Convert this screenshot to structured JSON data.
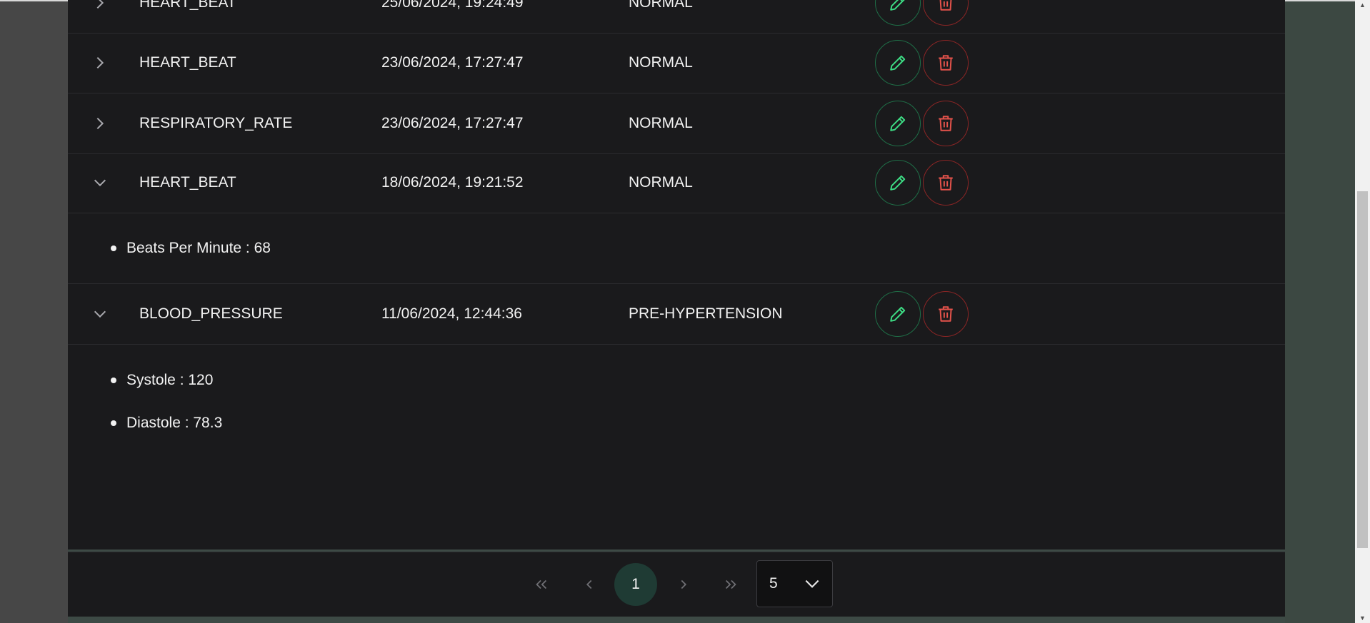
{
  "records": [
    {
      "type": "HEART_BEAT",
      "date": "25/06/2024, 19:24:49",
      "status": "NORMAL",
      "expanded": false
    },
    {
      "type": "HEART_BEAT",
      "date": "23/06/2024, 17:27:47",
      "status": "NORMAL",
      "expanded": false
    },
    {
      "type": "RESPIRATORY_RATE",
      "date": "23/06/2024, 17:27:47",
      "status": "NORMAL",
      "expanded": false
    },
    {
      "type": "HEART_BEAT",
      "date": "18/06/2024, 19:21:52",
      "status": "NORMAL",
      "expanded": true,
      "details": [
        {
          "text": "Beats Per Minute : 68"
        }
      ]
    },
    {
      "type": "BLOOD_PRESSURE",
      "date": "11/06/2024, 12:44:36",
      "status": "PRE-HYPERTENSION",
      "expanded": true,
      "details": [
        {
          "text": "Systole : 120"
        },
        {
          "text": "Diastole : 78.3"
        }
      ]
    }
  ],
  "icons": {
    "expand": "chevron-right-icon",
    "collapse": "chevron-down-icon",
    "edit": "pencil-icon",
    "delete": "trash-icon"
  },
  "colors": {
    "edit_accent": "#3ddc84",
    "delete_accent": "#e5534b",
    "current_page_bg": "#1f3b34"
  },
  "pagination": {
    "current_page": "1",
    "page_size": "5"
  }
}
